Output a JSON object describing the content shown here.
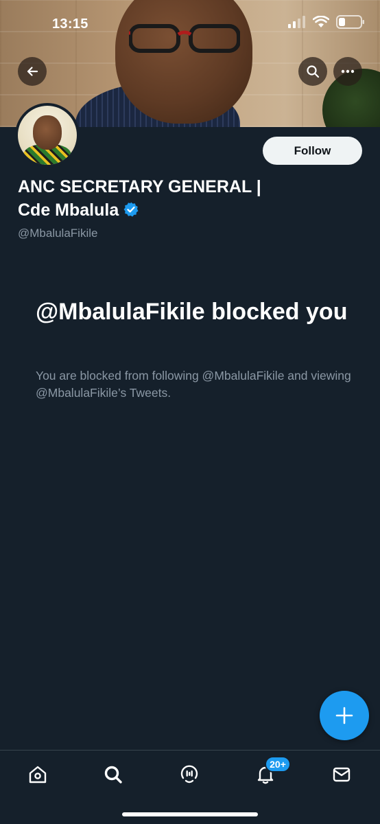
{
  "status_bar": {
    "time": "13:15"
  },
  "header": {
    "back_icon": "arrow-left-icon",
    "search_icon": "search-icon",
    "more_icon": "more-horizontal-icon"
  },
  "profile": {
    "name_line1": "ANC SECRETARY GENERAL |",
    "name_line2": "Cde Mbalula",
    "verified": true,
    "handle": "@MbalulaFikile",
    "follow_label": "Follow"
  },
  "blocked": {
    "title": "@MbalulaFikile blocked you",
    "message": "You are blocked from following @MbalulaFikile and viewing @MbalulaFikile’s Tweets."
  },
  "tabbar": {
    "items": [
      {
        "icon": "home-icon"
      },
      {
        "icon": "search-icon"
      },
      {
        "icon": "spaces-icon"
      },
      {
        "icon": "notifications-icon"
      },
      {
        "icon": "messages-icon"
      }
    ],
    "notification_count": "20+"
  },
  "colors": {
    "background": "#15202b",
    "accent": "#1d9bf0",
    "secondary_text": "#8b98a5",
    "divider": "#38444d"
  }
}
